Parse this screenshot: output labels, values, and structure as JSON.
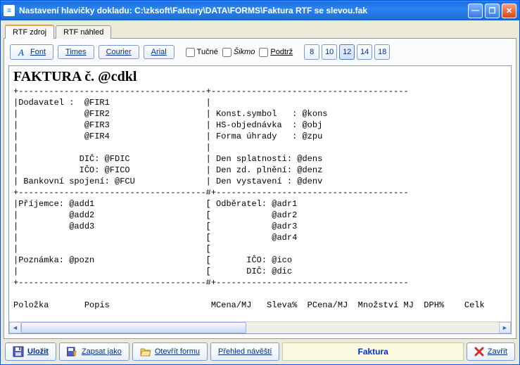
{
  "titlebar": {
    "text": "Nastavení hlavičky dokladu: C:\\zksoft\\Faktury\\DATA\\FORMS\\Faktura RTF se slevou.fak"
  },
  "tabs": {
    "source": "RTF zdroj",
    "preview": "RTF náhled"
  },
  "toolbar": {
    "font": "Font",
    "times": "Times",
    "courier": "Courier",
    "arial": "Arial",
    "bold": "Tučné",
    "italic": "Šikmo",
    "underline": "Podtrž",
    "sizes": [
      "8",
      "10",
      "12",
      "14",
      "18"
    ],
    "active_size": "12"
  },
  "editor": {
    "heading": "FAKTURA č. @cdkl",
    "body": "+-------------------------------------+---------------------------------------\n|Dodavatel :  @FIR1                   |\n|             @FIR2                   | Konst.symbol   : @kons\n|             @FIR3                   | HS-objednávka  : @obj\n|             @FIR4                   | Forma úhrady   : @zpu\n|                                     |\n|            DIČ: @FDIC               | Den splatnosti: @dens\n|            IČO: @FICO               | Den zd. plnění: @denz\n| Bankovní spojení: @FCU              | Den vystavení : @denv\n+-------------------------------------#+--------------------------------------\n|Příjemce: @add1                      [ Odběratel: @adr1\n|          @add2                      [            @adr2\n|          @add3                      [            @adr3\n|                                     [            @adr4\n|                                     [\n|Poznámka: @pozn                      [       IČO: @ico\n|                                     [       DIČ: @dic\n+-------------------------------------#+--------------------------------------\n\nPoložka       Popis                    MCena/MJ   Sleva%  PCena/MJ  Množství MJ  DPH%    Celk"
  },
  "bottombar": {
    "save": "Uložit",
    "saveas": "Zapsat jako",
    "open": "Otevřít formu",
    "overview": "Přehled návěští",
    "close": "Zavřít",
    "status": "Faktura"
  }
}
